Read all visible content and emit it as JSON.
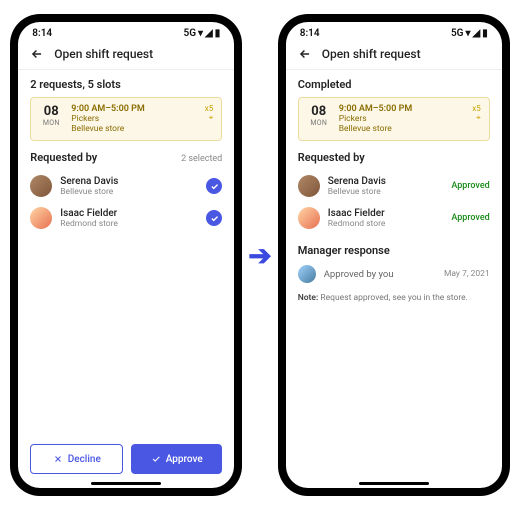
{
  "status": {
    "time": "8:14",
    "net": "5G"
  },
  "header": {
    "title": "Open shift request"
  },
  "left": {
    "summary": "2 requests, 5 slots",
    "shift": {
      "dayNum": "08",
      "dayDow": "MON",
      "time": "9:00 AM–5:00 PM",
      "role": "Pickers",
      "location": "Bellevue store",
      "slots": "x5"
    },
    "reqTitle": "Requested by",
    "reqSub": "2 selected",
    "people": [
      {
        "name": "Serena Davis",
        "sub": "Bellevue store"
      },
      {
        "name": "Isaac Fielder",
        "sub": "Redmond store"
      }
    ],
    "declineLabel": "Decline",
    "approveLabel": "Approve"
  },
  "right": {
    "summary": "Completed",
    "shift": {
      "dayNum": "08",
      "dayDow": "MON",
      "time": "9:00 AM–5:00 PM",
      "role": "Pickers",
      "location": "Bellevue store",
      "slots": "x5"
    },
    "reqTitle": "Requested by",
    "status": "Approved",
    "people": [
      {
        "name": "Serena Davis",
        "sub": "Bellevue store"
      },
      {
        "name": "Isaac Fielder",
        "sub": "Redmond store"
      }
    ],
    "mgrTitle": "Manager response",
    "mgrText": "Approved by you",
    "mgrDate": "May 7, 2021",
    "noteLabel": "Note:",
    "noteText": " Request approved, see you in the store."
  }
}
